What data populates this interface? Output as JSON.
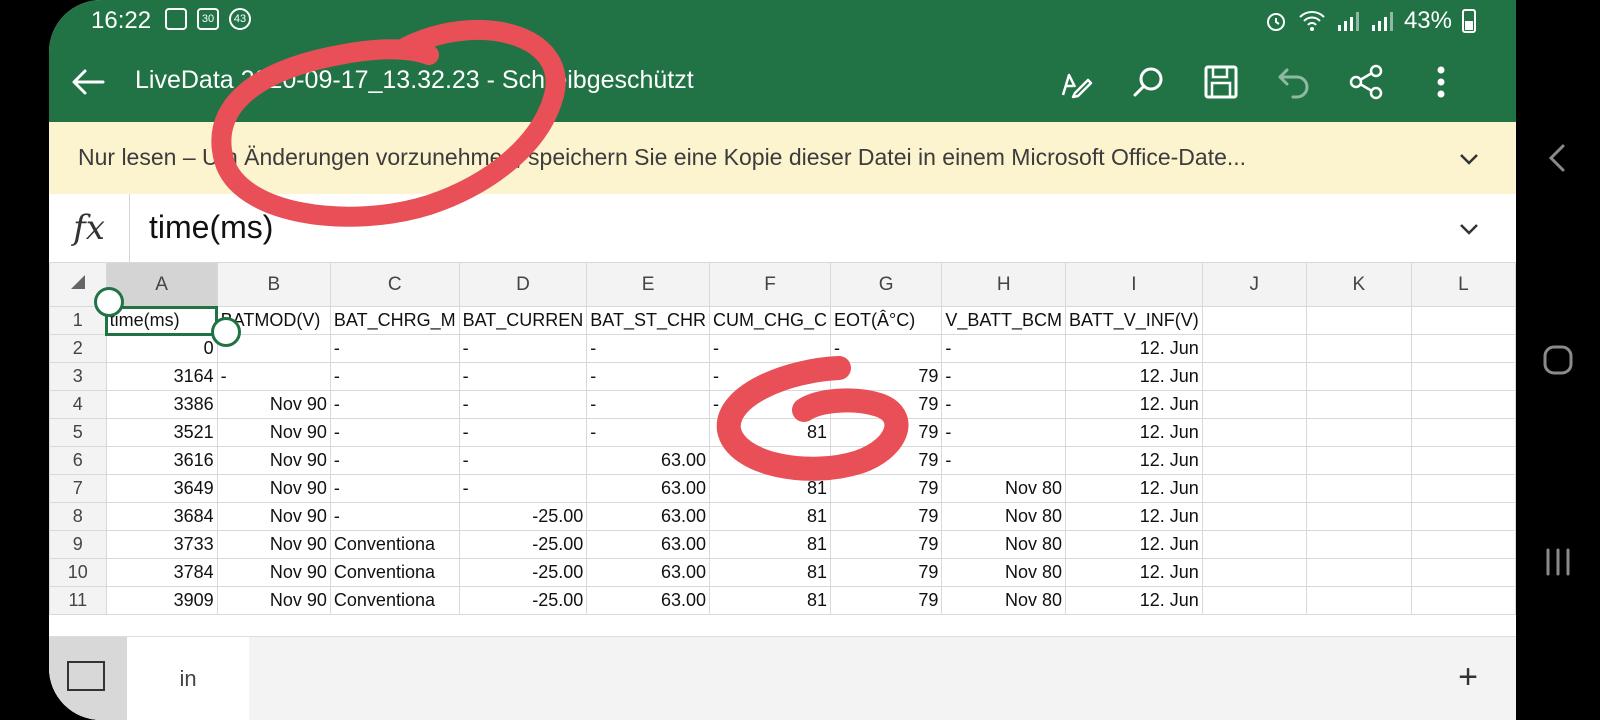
{
  "status": {
    "time": "16:22",
    "badge_30": "30",
    "badge_43": "43",
    "battery": "43%"
  },
  "app_bar": {
    "title": "LiveData 2020-09-17_13.32.23 - Schreibgeschützt",
    "icons": [
      "back-arrow-icon",
      "pen-icon",
      "search-icon",
      "save-icon",
      "undo-icon",
      "share-icon",
      "more-icon"
    ]
  },
  "readonly_bar": {
    "text": "Nur lesen – Um Änderungen vorzunehmen, speichern Sie eine Kopie dieser Datei in einem Microsoft Office-Date..."
  },
  "formula_bar": {
    "fx_label": "fx",
    "value": "time(ms)"
  },
  "sheet": {
    "columns": [
      "A",
      "B",
      "C",
      "D",
      "E",
      "F",
      "G",
      "H",
      "I",
      "J",
      "K",
      "L"
    ],
    "selected_column": "A",
    "rows": [
      {
        "num": "1",
        "cells": [
          "time(ms)",
          "BATMOD(V)",
          "BAT_CHRG_M",
          "BAT_CURREN",
          "BAT_ST_CHR",
          "CUM_CHG_C",
          "EOT(Â°C)",
          "V_BATT_BCM",
          "BATT_V_INF(V)",
          "",
          "",
          ""
        ]
      },
      {
        "num": "2",
        "cells": [
          "0",
          "",
          "-",
          "-",
          "-",
          "-",
          "-",
          "-",
          "12. Jun",
          "",
          "",
          ""
        ]
      },
      {
        "num": "3",
        "cells": [
          "3164",
          "-",
          "-",
          "-",
          "-",
          "-",
          "79",
          "-",
          "12. Jun",
          "",
          "",
          ""
        ]
      },
      {
        "num": "4",
        "cells": [
          "3386",
          "Nov 90",
          "-",
          "-",
          "-",
          "-",
          "79",
          "-",
          "12. Jun",
          "",
          "",
          ""
        ]
      },
      {
        "num": "5",
        "cells": [
          "3521",
          "Nov 90",
          "-",
          "-",
          "-",
          "81",
          "79",
          "-",
          "12. Jun",
          "",
          "",
          ""
        ]
      },
      {
        "num": "6",
        "cells": [
          "3616",
          "Nov 90",
          "-",
          "-",
          "63.00",
          "",
          "79",
          "-",
          "12. Jun",
          "",
          "",
          ""
        ]
      },
      {
        "num": "7",
        "cells": [
          "3649",
          "Nov 90",
          "-",
          "-",
          "63.00",
          "81",
          "79",
          "Nov 80",
          "12. Jun",
          "",
          "",
          ""
        ]
      },
      {
        "num": "8",
        "cells": [
          "3684",
          "Nov 90",
          "-",
          "-25.00",
          "63.00",
          "81",
          "79",
          "Nov 80",
          "12. Jun",
          "",
          "",
          ""
        ]
      },
      {
        "num": "9",
        "cells": [
          "3733",
          "Nov 90",
          "Conventiona",
          "-25.00",
          "63.00",
          "81",
          "79",
          "Nov 80",
          "12. Jun",
          "",
          "",
          ""
        ]
      },
      {
        "num": "10",
        "cells": [
          "3784",
          "Nov 90",
          "Conventiona",
          "-25.00",
          "63.00",
          "81",
          "79",
          "Nov 80",
          "12. Jun",
          "",
          "",
          ""
        ]
      },
      {
        "num": "11",
        "cells": [
          "3909",
          "Nov 90",
          "Conventiona",
          "-25.00",
          "63.00",
          "81",
          "79",
          "Nov 80",
          "12. Jun",
          "",
          "",
          ""
        ]
      }
    ]
  },
  "sheet_bar": {
    "tab_label": "in",
    "add_label": "+"
  },
  "colors": {
    "excel_green": "#217346",
    "readonly_yellow": "#fcf3cf",
    "annotation_red": "#e94f56"
  },
  "nav_bar": {
    "icons": [
      "back-chevron-icon",
      "home-icon",
      "recents-icon"
    ]
  }
}
